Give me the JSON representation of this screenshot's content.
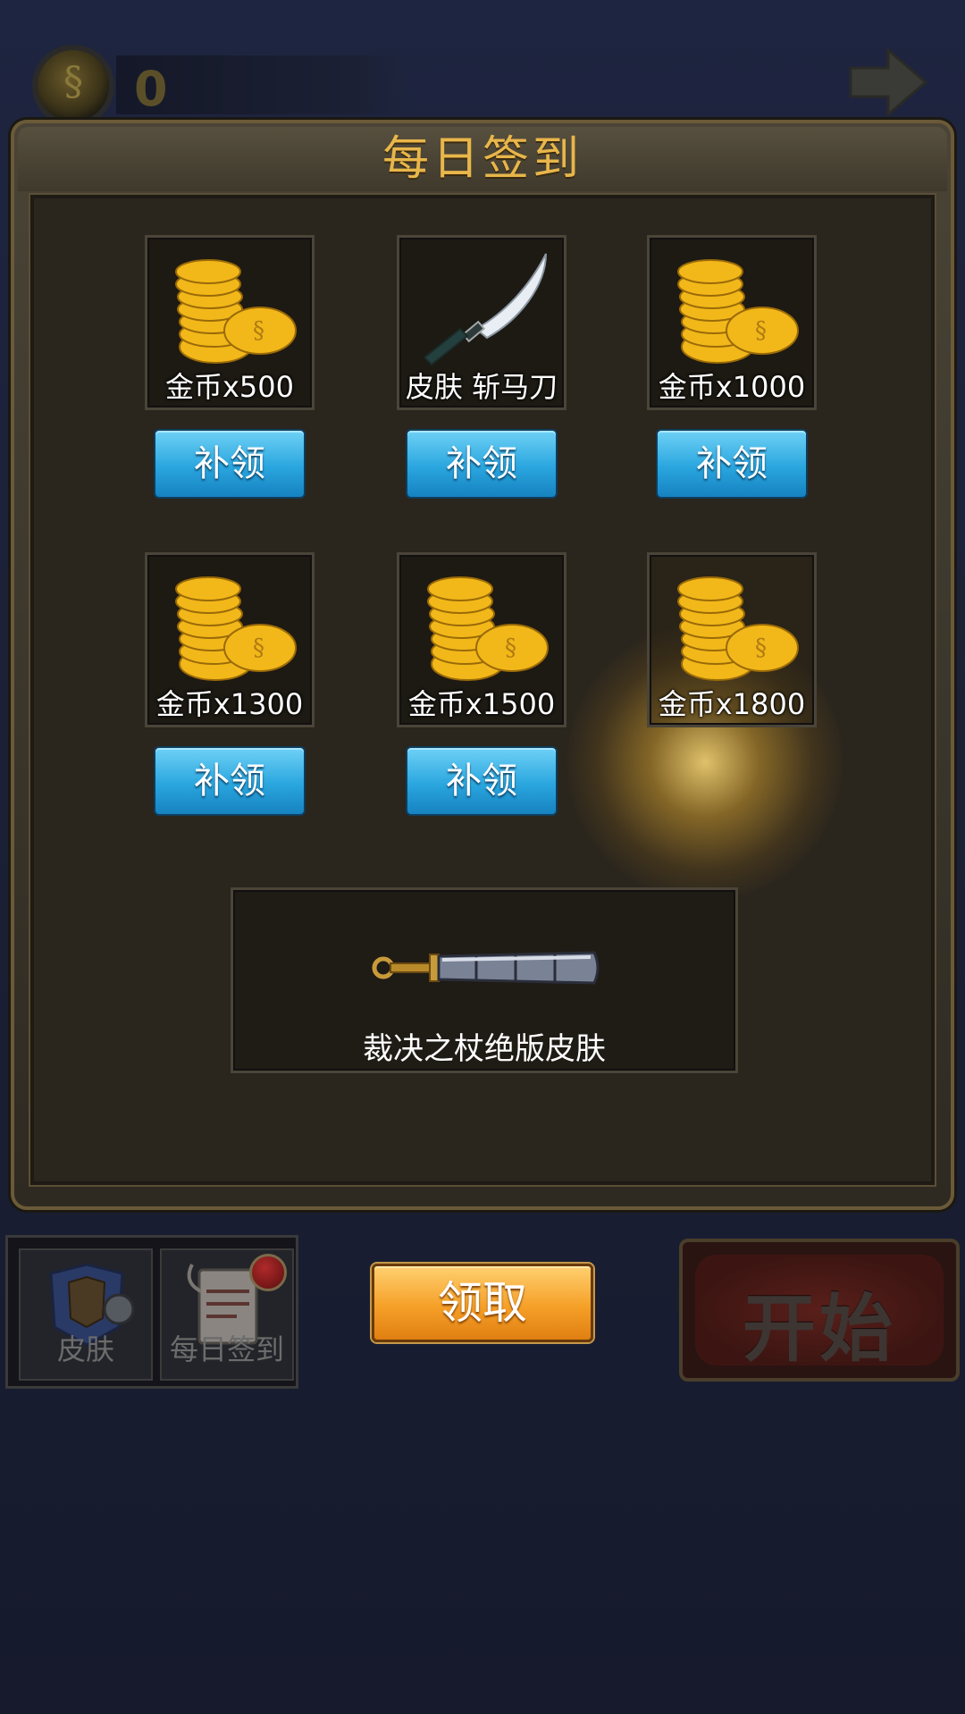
{
  "currency": {
    "coin_count": "0",
    "icon": "gold-coin-icon"
  },
  "header": {
    "next_icon": "arrow-right-icon"
  },
  "daily_signin": {
    "title": "每日签到",
    "rewards": [
      {
        "label": "金币x500",
        "icon": "coins-icon",
        "button": "补领"
      },
      {
        "label": "皮肤 斩马刀",
        "icon": "sword-icon",
        "button": "补领"
      },
      {
        "label": "金币x1000",
        "icon": "coins-icon",
        "button": "补领"
      },
      {
        "label": "金币x1300",
        "icon": "coins-icon",
        "button": "补领"
      },
      {
        "label": "金币x1500",
        "icon": "coins-icon",
        "button": "补领"
      },
      {
        "label": "金币x1800",
        "icon": "coins-icon",
        "highlighted": true
      }
    ],
    "final_reward": {
      "label": "裁决之杖绝版皮肤",
      "icon": "staff-icon"
    }
  },
  "bottom": {
    "tabs": [
      {
        "label": "皮肤",
        "icon": "armor-icon"
      },
      {
        "label": "每日签到",
        "icon": "scroll-icon",
        "badge": true
      }
    ],
    "receive_button": "领取",
    "start_button": "开始"
  },
  "colors": {
    "title": "#e8b64a",
    "claim_button": "#2aa6df",
    "receive_button": "#f5a028",
    "background": "#1b2036"
  }
}
